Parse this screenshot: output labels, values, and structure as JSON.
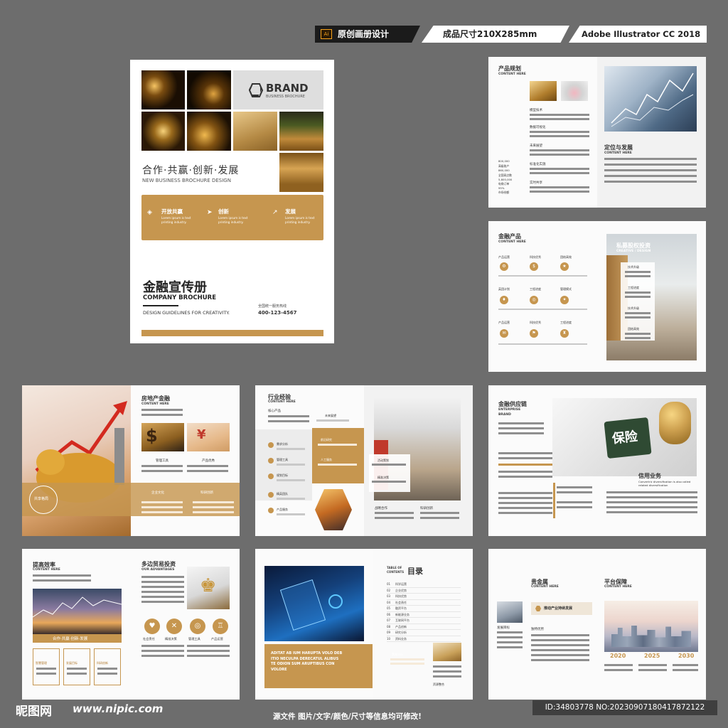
{
  "header": {
    "tag1": "原创画册设计",
    "tag2": "成品尺寸210X285mm",
    "tag3": "Adobe Illustrator CC 2018",
    "ai_icon": "Ai"
  },
  "cover": {
    "brand": "BRAND",
    "brand_sub": "BUSINESS BROCHURE",
    "slogan": "合作·共赢·创新·发展",
    "slogan_en": "NEW BUSINESS  BROCHURE DESIGN",
    "features": [
      {
        "title": "开放共赢",
        "text": "Lorem ipsum is text printing industry."
      },
      {
        "title": "创新",
        "text": "Lorem ipsum is text printing industry."
      },
      {
        "title": "发展",
        "text": "Lorem ipsum is text printing industry."
      }
    ],
    "title_cn": "金融宣传册",
    "title_en": "COMPANY BROCHURE",
    "guideline": "DESIGN GUIDELINES FOR CREATIVITY.",
    "hotline_label": "全国统一服务热线",
    "hotline": "400-123-4567"
  },
  "common": {
    "content_here": "CONTENT HERE"
  },
  "p1": {
    "title": "产品规划",
    "items": [
      "模型技术",
      "数据可视化",
      "未来展望",
      "标准化实施",
      "实时共享"
    ],
    "left_stats": [
      "800,000",
      "高级账户",
      "860,000",
      "全国网点数",
      "5,800,000",
      "电商订单",
      "95%",
      "市场份额"
    ],
    "right_title": "定位与发展"
  },
  "p2": {
    "title": "金融产品",
    "grid": [
      "产品运营",
      "科技优秀",
      "团结高效",
      "英团计划",
      "工程进度",
      "管理模式",
      "产品运营",
      "科技优秀",
      "工程进度"
    ],
    "right_title": "私募股权投资",
    "right_sub": "CREATIVE / DESIGN",
    "right_items": [
      "技术升级",
      "工程进度",
      "技术升级",
      "团结高效"
    ]
  },
  "p3": {
    "title": "房地产金融",
    "labels": [
      "管理工具",
      "产品优秀",
      "企业文化",
      "科研创新"
    ],
    "badge": "共享格局"
  },
  "p4": {
    "title": "行业经验",
    "left_sub": "核心产品",
    "left_items": [
      "需求分析",
      "管理工具",
      "规划目标",
      "精英团队",
      "产品服务"
    ],
    "mid_items": [
      "未来展望",
      "前沿研究",
      "人工服务"
    ],
    "right_items": [
      "活动策划",
      "精准决策"
    ],
    "bottom": [
      "战略合作",
      "科研创新"
    ]
  },
  "p5": {
    "title": "金融供应链",
    "en1": "ENTERPRISE",
    "en2": "BRAND",
    "puzzle_word": "保险",
    "right_title": "信用业务",
    "right_text": "Convertric diversification is also called related diversification"
  },
  "p6": {
    "title": "提高效率",
    "banner": "合作·共赢·创新·发展",
    "boxes": [
      "智慧管理",
      "发展目标",
      "科研创新"
    ],
    "right_title": "多边贸易投资",
    "right_sub": "OUR ADVANTAGES",
    "icons": [
      "社会责任",
      "精准决策",
      "管理工具",
      "产品运营"
    ]
  },
  "p7": {
    "latin": "ADITAT AB IUM HARUPTA VOLO DEB ITIO NECULPA DERECATUL ALIBUS TE ODION SUM ARUPTIBUS CON VOLORE",
    "toc_en1": "TABLE OF",
    "toc_en2": "CONTENTS",
    "toc_cn": "目录",
    "toc": [
      {
        "n": "01",
        "t": "科学运营"
      },
      {
        "n": "02",
        "t": "企业优势"
      },
      {
        "n": "03",
        "t": "科技优势"
      },
      {
        "n": "04",
        "t": "社会责任"
      },
      {
        "n": "05",
        "t": "融资平台"
      },
      {
        "n": "06",
        "t": "新能源业务"
      },
      {
        "n": "07",
        "t": "互联网平台"
      },
      {
        "n": "08",
        "t": "产品创新"
      },
      {
        "n": "09",
        "t": "研究分析"
      },
      {
        "n": "10",
        "t": "资料业务"
      }
    ],
    "side_label": "策略分析",
    "bottom_label": "资源整合"
  },
  "p8": {
    "title": "贵金属",
    "left_title": "发展目标",
    "box_title": "推动产业持续发展",
    "sub_title": "独特优势",
    "right_title": "平台保障",
    "years": [
      "2020",
      "2025",
      "2030"
    ]
  },
  "footer": {
    "logo": "昵图网",
    "url": "www.nipic.com",
    "note": "源文件 图片/文字/颜色/尺寸等信息均可修改!",
    "id": "ID:34803778 NO:20230907180417872122"
  }
}
